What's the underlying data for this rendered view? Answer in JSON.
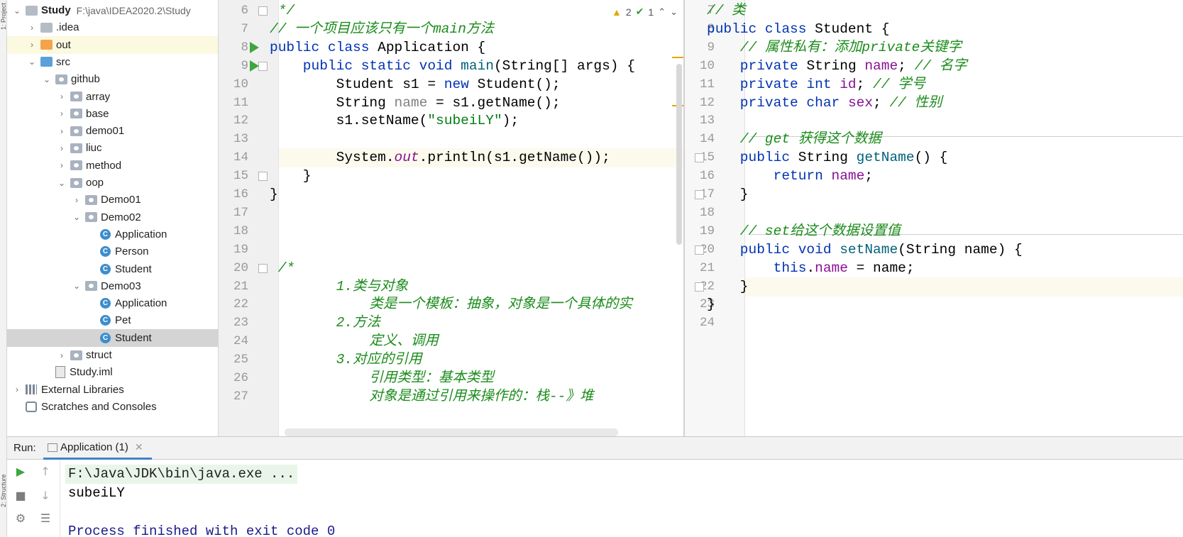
{
  "left_strip": {
    "top_label": "1: Project",
    "bottom_label": "2: Structure"
  },
  "project_tree": {
    "items": [
      {
        "label": "Study",
        "path": "F:\\java\\IDEA2020.2\\Study",
        "icon": "folder-icon",
        "arrow": "v"
      },
      {
        "label": ".idea",
        "icon": "folder-icon",
        "arrow": ">"
      },
      {
        "label": "out",
        "icon": "folder-orange-icon",
        "arrow": ">"
      },
      {
        "label": "src",
        "icon": "folder-blue-icon",
        "arrow": "v"
      },
      {
        "label": "github",
        "icon": "package-icon",
        "arrow": "v"
      },
      {
        "label": "array",
        "icon": "package-icon",
        "arrow": ">"
      },
      {
        "label": "base",
        "icon": "package-icon",
        "arrow": ">"
      },
      {
        "label": "demo01",
        "icon": "package-icon",
        "arrow": ">"
      },
      {
        "label": "liuc",
        "icon": "package-icon",
        "arrow": ">"
      },
      {
        "label": "method",
        "icon": "package-icon",
        "arrow": ">"
      },
      {
        "label": "oop",
        "icon": "package-icon",
        "arrow": "v"
      },
      {
        "label": "Demo01",
        "icon": "package-icon",
        "arrow": ">"
      },
      {
        "label": "Demo02",
        "icon": "package-icon",
        "arrow": "v"
      },
      {
        "label": "Application",
        "icon": "class-icon",
        "arrow": ""
      },
      {
        "label": "Person",
        "icon": "class-icon",
        "arrow": ""
      },
      {
        "label": "Student",
        "icon": "class-icon",
        "arrow": ""
      },
      {
        "label": "Demo03",
        "icon": "package-icon",
        "arrow": "v"
      },
      {
        "label": "Application",
        "icon": "class-icon",
        "arrow": ""
      },
      {
        "label": "Pet",
        "icon": "class-icon",
        "arrow": ""
      },
      {
        "label": "Student",
        "icon": "class-icon",
        "arrow": ""
      },
      {
        "label": "struct",
        "icon": "package-icon",
        "arrow": ">"
      },
      {
        "label": "Study.iml",
        "icon": "file-icon",
        "arrow": ""
      },
      {
        "label": "External Libraries",
        "icon": "library-icon",
        "arrow": ">"
      },
      {
        "label": "Scratches and Consoles",
        "icon": "scratch-icon",
        "arrow": ""
      }
    ]
  },
  "editor_left": {
    "warnings": "2",
    "oks": "1",
    "line_numbers": [
      "6",
      "7",
      "8",
      "9",
      "10",
      "11",
      "12",
      "13",
      "14",
      "15",
      "16",
      "17",
      "18",
      "19",
      "20",
      "21",
      "22",
      "23",
      "24",
      "25",
      "26",
      "27"
    ],
    "lines": [
      [
        {
          "t": " */",
          "c": "com"
        }
      ],
      [
        {
          "t": "// 一个项目应该只有一个main方法",
          "c": "com"
        }
      ],
      [
        {
          "t": "public class ",
          "c": "kw"
        },
        {
          "t": "Application {",
          "c": ""
        }
      ],
      [
        {
          "t": "    public static void ",
          "c": "kw"
        },
        {
          "t": "main",
          "c": "meth"
        },
        {
          "t": "(String[] args) {",
          "c": ""
        }
      ],
      [
        {
          "t": "        Student s1 = ",
          "c": ""
        },
        {
          "t": "new ",
          "c": "kw"
        },
        {
          "t": "Student();",
          "c": ""
        }
      ],
      [
        {
          "t": "        String ",
          "c": ""
        },
        {
          "t": "name",
          "c": "dim"
        },
        {
          "t": " = s1.getName();",
          "c": ""
        }
      ],
      [
        {
          "t": "        s1.setName(",
          "c": ""
        },
        {
          "t": "\"subeiLY\"",
          "c": "str"
        },
        {
          "t": ");",
          "c": ""
        }
      ],
      [
        {
          "t": "",
          "c": ""
        }
      ],
      [
        {
          "t": "        System.",
          "c": ""
        },
        {
          "t": "out",
          "c": "fldit"
        },
        {
          "t": ".println(s1.getName());",
          "c": ""
        }
      ],
      [
        {
          "t": "    }",
          "c": ""
        }
      ],
      [
        {
          "t": "}",
          "c": ""
        }
      ],
      [
        {
          "t": "",
          "c": ""
        }
      ],
      [
        {
          "t": "",
          "c": ""
        }
      ],
      [
        {
          "t": "",
          "c": ""
        }
      ],
      [
        {
          "t": " /*",
          "c": "com"
        }
      ],
      [
        {
          "t": "        1.类与对象",
          "c": "com"
        }
      ],
      [
        {
          "t": "            类是一个模板：抽象，对象是一个具体的实",
          "c": "com"
        }
      ],
      [
        {
          "t": "        2.方法",
          "c": "com"
        }
      ],
      [
        {
          "t": "            定义、调用",
          "c": "com"
        }
      ],
      [
        {
          "t": "        3.对应的引用",
          "c": "com"
        }
      ],
      [
        {
          "t": "            引用类型：基本类型",
          "c": "com"
        }
      ],
      [
        {
          "t": "            对象是通过引用来操作的：栈--》堆",
          "c": "com"
        }
      ]
    ]
  },
  "editor_right": {
    "line_numbers": [
      "7",
      "8",
      "9",
      "10",
      "11",
      "12",
      "13",
      "14",
      "15",
      "16",
      "17",
      "18",
      "19",
      "20",
      "21",
      "22",
      "23",
      "24"
    ],
    "lines": [
      [
        {
          "t": "// 类",
          "c": "com"
        }
      ],
      [
        {
          "t": "public class ",
          "c": "kw"
        },
        {
          "t": "Student {",
          "c": ""
        }
      ],
      [
        {
          "t": "    // 属性私有：添加private关键字",
          "c": "com"
        }
      ],
      [
        {
          "t": "    private ",
          "c": "kw"
        },
        {
          "t": "String ",
          "c": ""
        },
        {
          "t": "name",
          "c": "fld"
        },
        {
          "t": "; ",
          "c": ""
        },
        {
          "t": "// 名字",
          "c": "com"
        }
      ],
      [
        {
          "t": "    private int ",
          "c": "kw"
        },
        {
          "t": "id",
          "c": "fld"
        },
        {
          "t": "; ",
          "c": ""
        },
        {
          "t": "// 学号",
          "c": "com"
        }
      ],
      [
        {
          "t": "    private char ",
          "c": "kw"
        },
        {
          "t": "sex",
          "c": "fld"
        },
        {
          "t": "; ",
          "c": ""
        },
        {
          "t": "// 性别",
          "c": "com"
        }
      ],
      [
        {
          "t": "",
          "c": ""
        }
      ],
      [
        {
          "t": "    // get 获得这个数据",
          "c": "com"
        }
      ],
      [
        {
          "t": "    public ",
          "c": "kw"
        },
        {
          "t": "String ",
          "c": ""
        },
        {
          "t": "getName",
          "c": "meth"
        },
        {
          "t": "() {",
          "c": ""
        }
      ],
      [
        {
          "t": "        return ",
          "c": "kw"
        },
        {
          "t": "name",
          "c": "fld"
        },
        {
          "t": ";",
          "c": ""
        }
      ],
      [
        {
          "t": "    }",
          "c": ""
        }
      ],
      [
        {
          "t": "",
          "c": ""
        }
      ],
      [
        {
          "t": "    // set给这个数据设置值",
          "c": "com"
        }
      ],
      [
        {
          "t": "    public void ",
          "c": "kw"
        },
        {
          "t": "setName",
          "c": "meth"
        },
        {
          "t": "(String name) {",
          "c": ""
        }
      ],
      [
        {
          "t": "        this",
          "c": "kw"
        },
        {
          "t": ".",
          "c": ""
        },
        {
          "t": "name",
          "c": "fld"
        },
        {
          "t": " = name;",
          "c": ""
        }
      ],
      [
        {
          "t": "    }",
          "c": ""
        }
      ],
      [
        {
          "t": "}",
          "c": ""
        }
      ],
      [
        {
          "t": "",
          "c": ""
        }
      ]
    ]
  },
  "run_panel": {
    "label": "Run:",
    "tab_label": "Application (1)",
    "output": [
      "F:\\Java\\JDK\\bin\\java.exe ...",
      "subeiLY",
      "",
      "Process finished with exit code 0"
    ]
  }
}
